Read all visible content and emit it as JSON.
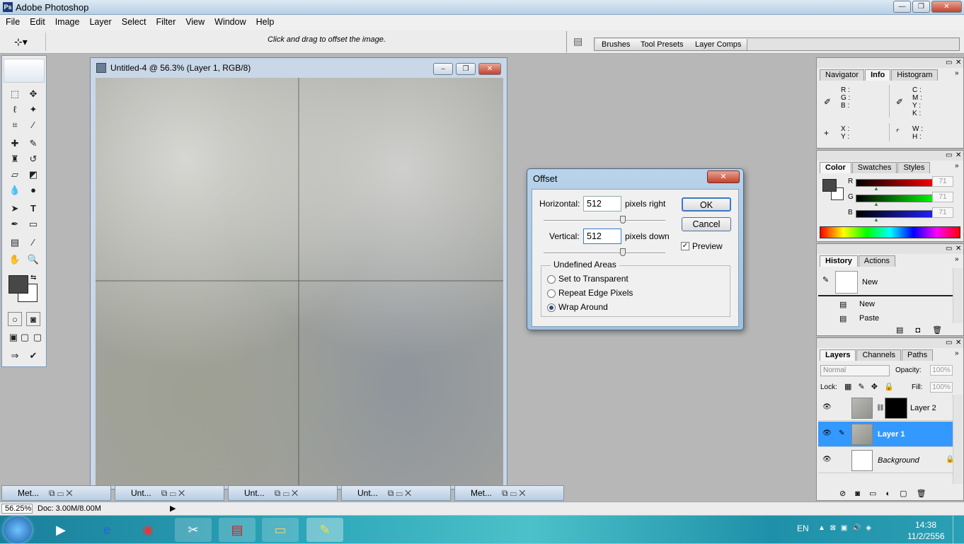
{
  "window": {
    "title": "Adobe Photoshop",
    "min": "—",
    "restore": "❐",
    "close": "✕"
  },
  "menu": [
    "File",
    "Edit",
    "Image",
    "Layer",
    "Select",
    "Filter",
    "View",
    "Window",
    "Help"
  ],
  "options": {
    "hint": "Click and drag to offset the image."
  },
  "palette_tabs": [
    "Brushes",
    "Tool Presets",
    "Layer Comps"
  ],
  "doc": {
    "title": "Untitled-4 @ 56.3% (Layer 1, RGB/8)"
  },
  "minidocs": [
    "Met...",
    "Unt...",
    "Unt...",
    "Unt...",
    "Met..."
  ],
  "status": {
    "zoom": "56.25%",
    "doc": "Doc: 3.00M/8.00M"
  },
  "dialog": {
    "title": "Offset",
    "horizontal_label": "Horizontal:",
    "horizontal_value": "512",
    "horizontal_unit": "pixels right",
    "vertical_label": "Vertical:",
    "vertical_value": "512",
    "vertical_unit": "pixels down",
    "ok": "OK",
    "cancel": "Cancel",
    "preview": "Preview",
    "preview_checked": true,
    "undefined_title": "Undefined Areas",
    "options": [
      "Set to Transparent",
      "Repeat Edge Pixels",
      "Wrap Around"
    ],
    "selected": "Wrap Around"
  },
  "info": {
    "tabs": [
      "Navigator",
      "Info",
      "Histogram"
    ],
    "active": "Info",
    "rgb": [
      "R :",
      "G :",
      "B :"
    ],
    "cmyk": [
      "C :",
      "M :",
      "Y :",
      "K :"
    ],
    "xy": [
      "X :",
      "Y :"
    ],
    "wh": [
      "W :",
      "H :"
    ]
  },
  "color": {
    "tabs": [
      "Color",
      "Swatches",
      "Styles"
    ],
    "active": "Color",
    "channels": [
      {
        "name": "R",
        "value": "71"
      },
      {
        "name": "G",
        "value": "71"
      },
      {
        "name": "B",
        "value": "71"
      }
    ]
  },
  "history": {
    "tabs": [
      "History",
      "Actions"
    ],
    "active": "History",
    "snapshot": "New",
    "items": [
      "New",
      "Paste"
    ]
  },
  "layers": {
    "tabs": [
      "Layers",
      "Channels",
      "Paths"
    ],
    "active": "Layers",
    "blend": "Normal",
    "opacity_label": "Opacity:",
    "opacity": "100%",
    "lock_label": "Lock:",
    "fill_label": "Fill:",
    "fill": "100%",
    "items": [
      "Layer 2",
      "Layer 1",
      "Background"
    ],
    "selected": "Layer 1"
  },
  "tray": {
    "lang": "EN",
    "time": "14:38",
    "date": "11/2/2556"
  }
}
